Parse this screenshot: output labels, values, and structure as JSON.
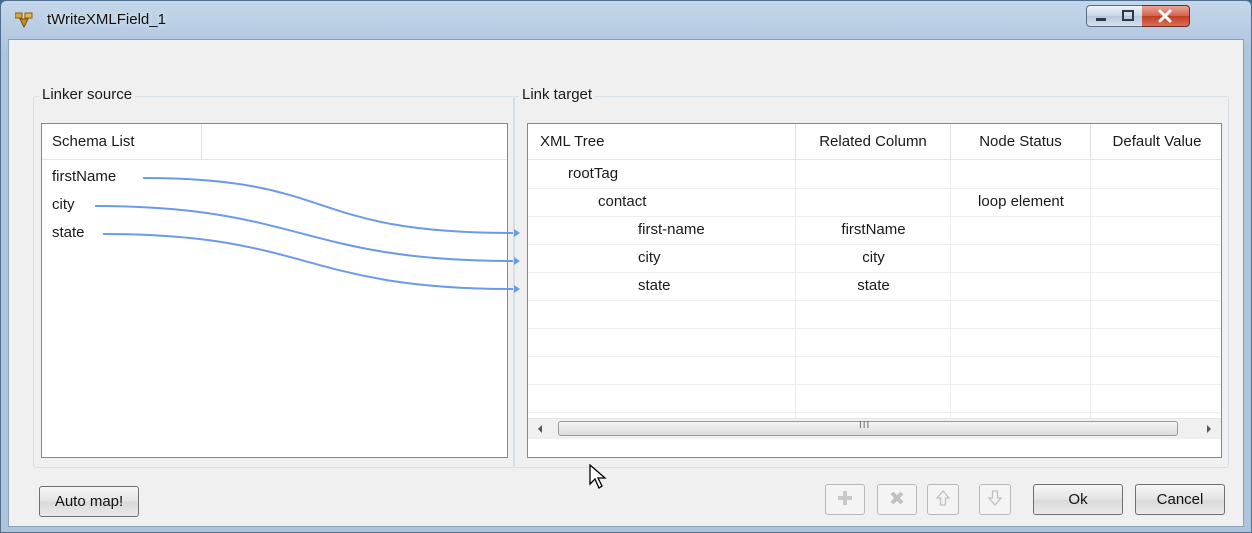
{
  "window": {
    "title": "tWriteXMLField_1"
  },
  "source": {
    "group_label": "Linker source",
    "columns": [
      "Schema List",
      ""
    ],
    "rows": [
      "firstName",
      "city",
      "state"
    ]
  },
  "target": {
    "group_label": "Link target",
    "columns": [
      "XML Tree",
      "Related Column",
      "Node Status",
      "Default Value"
    ],
    "rows": [
      {
        "tree": "rootTag",
        "related": "",
        "status": "",
        "default": ""
      },
      {
        "tree": "contact",
        "related": "",
        "status": "loop element",
        "default": ""
      },
      {
        "tree": "first-name",
        "related": "firstName",
        "status": "",
        "default": ""
      },
      {
        "tree": "city",
        "related": "city",
        "status": "",
        "default": ""
      },
      {
        "tree": "state",
        "related": "state",
        "status": "",
        "default": ""
      }
    ],
    "scroll_thumb_glyph": "III"
  },
  "buttons": {
    "auto_map": "Auto map!",
    "ok": "Ok",
    "cancel": "Cancel"
  },
  "icons": {
    "add": "plus-icon",
    "remove": "delete-icon",
    "up": "arrow-up-icon",
    "down": "arrow-down-icon"
  },
  "colors": {
    "link_line": "#6b9be8",
    "title_bar": "#b3c9e1",
    "close_button": "#c94a30"
  }
}
